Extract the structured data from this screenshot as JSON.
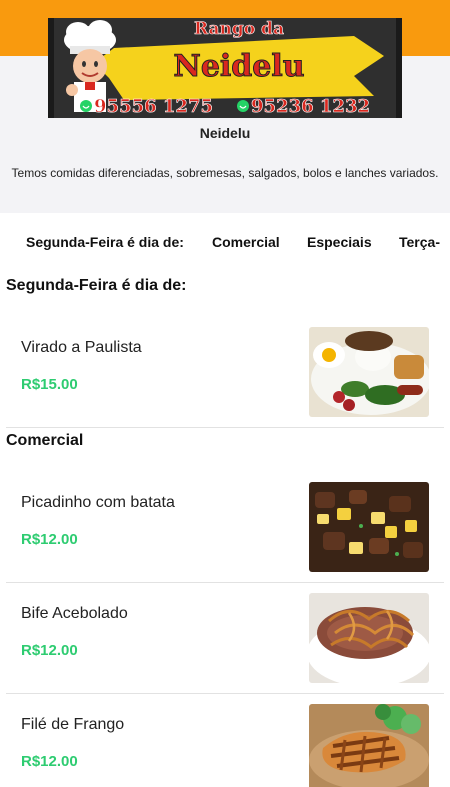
{
  "header": {
    "banner": {
      "line1": "Rango da",
      "line2": "Neidelu",
      "phone1": "95556 1275",
      "phone2": "95236 1232"
    },
    "store_name": "Neidelu",
    "store_description": "Temos comidas diferenciadas, sobremesas, salgados, bolos e lanches variados."
  },
  "categories": [
    {
      "label": "Segunda-Feira é dia de:"
    },
    {
      "label": "Comercial"
    },
    {
      "label": "Especiais"
    },
    {
      "label": "Terça-"
    }
  ],
  "sections": [
    {
      "title": "Segunda-Feira é dia de:",
      "items": [
        {
          "name": "Virado a Paulista",
          "price": "R$15.00"
        }
      ]
    },
    {
      "title": "Comercial",
      "items": [
        {
          "name": "Picadinho com batata",
          "price": "R$12.00"
        },
        {
          "name": "Bife Acebolado",
          "price": "R$12.00"
        },
        {
          "name": "Filé de Frango",
          "price": "R$12.00"
        }
      ]
    }
  ],
  "colors": {
    "header_orange": "#f99a0e",
    "price_green": "#2ecc71",
    "banner_yellow": "#f5d21c",
    "banner_red": "#d9281f"
  }
}
